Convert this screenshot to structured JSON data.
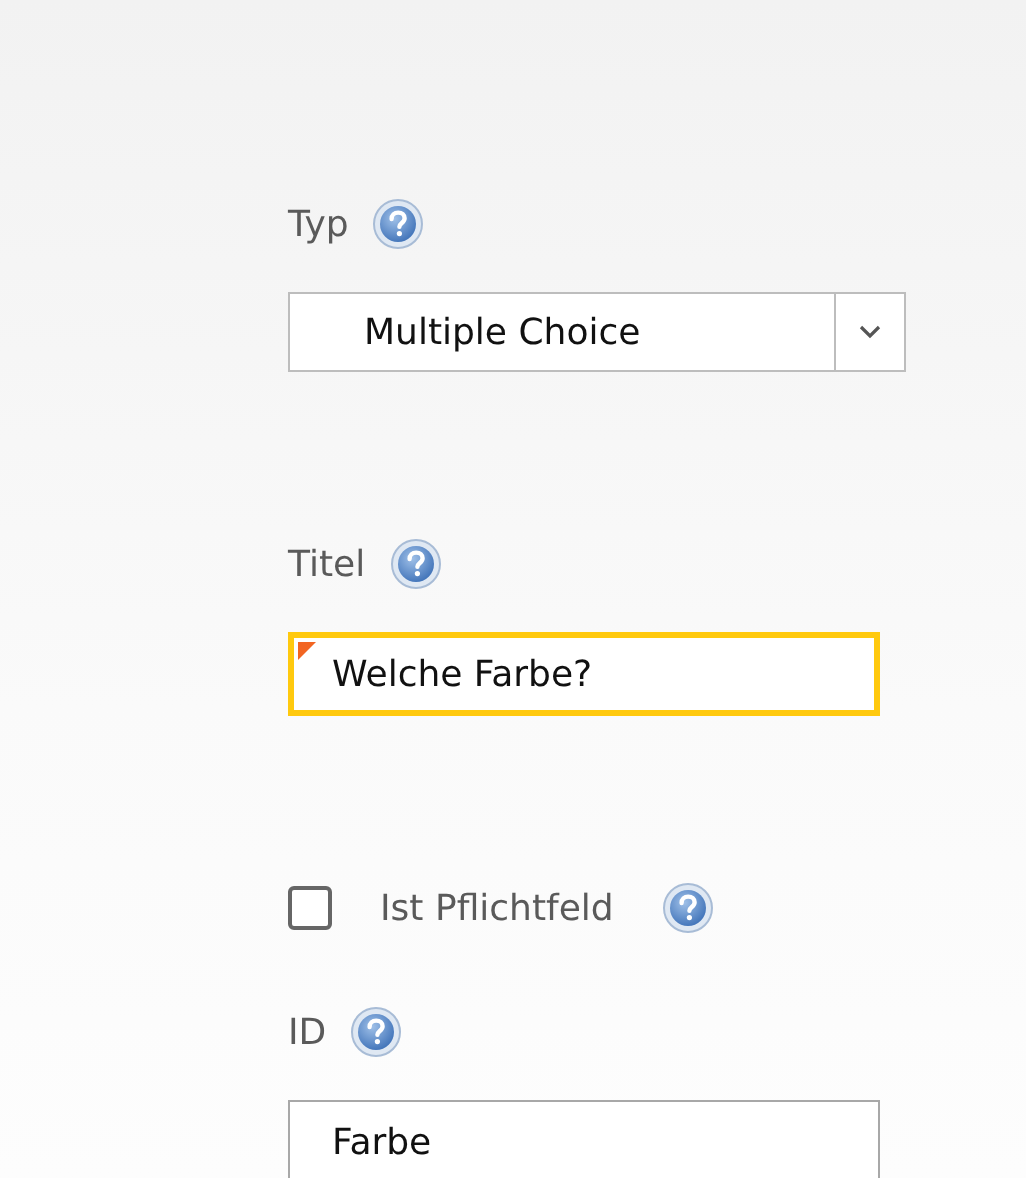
{
  "fields": [
    {
      "kind": "dropdown",
      "label": "Typ",
      "value": "Multiple Choice"
    },
    {
      "kind": "text",
      "label": "Titel",
      "value": "Welche Farbe?",
      "focused": true,
      "flagged": true
    },
    {
      "kind": "checkbox",
      "label": "Ist Pflichtfeld",
      "checked": false
    },
    {
      "kind": "text",
      "label": "ID",
      "value": "Farbe",
      "focused": false,
      "flagged": false
    }
  ]
}
